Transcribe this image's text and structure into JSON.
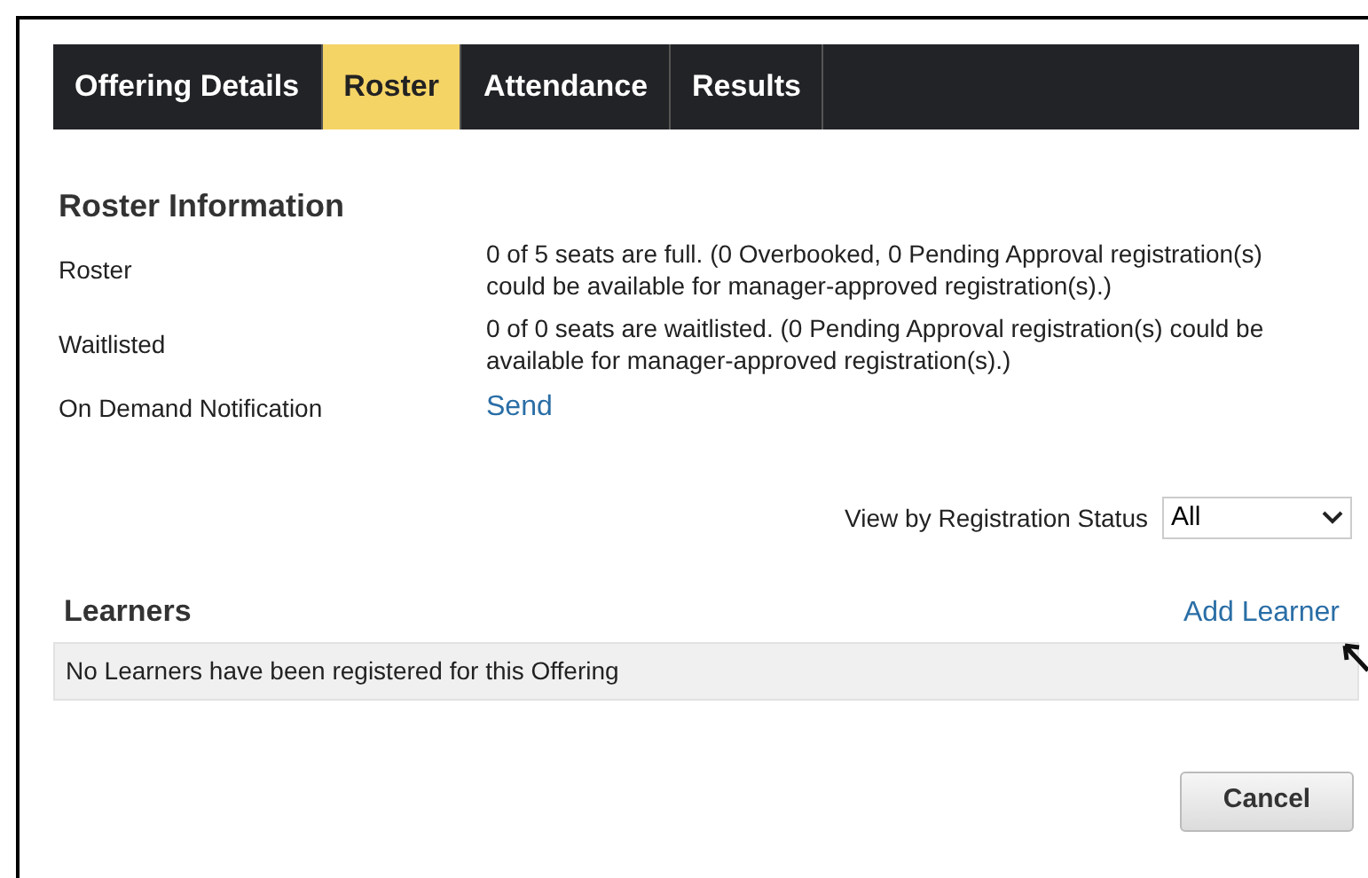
{
  "tabs": [
    {
      "label": "Offering Details",
      "selected": false
    },
    {
      "label": "Roster",
      "selected": true
    },
    {
      "label": "Attendance",
      "selected": false
    },
    {
      "label": "Results",
      "selected": false
    }
  ],
  "roster_information": {
    "title": "Roster Information",
    "rows": [
      {
        "label": "Roster",
        "kind": "text",
        "value": "0 of 5 seats are full. (0 Overbooked, 0 Pending Approval registration(s) could be available for manager-approved registration(s).)"
      },
      {
        "label": "Waitlisted",
        "kind": "text",
        "value": "0 of 0 seats are waitlisted. (0 Pending Approval registration(s) could be available for manager-approved registration(s).)"
      },
      {
        "label": "On Demand Notification",
        "kind": "link",
        "value": "Send"
      }
    ]
  },
  "filter": {
    "label": "View by Registration Status",
    "value": "All"
  },
  "learners": {
    "title": "Learners",
    "add_link": "Add Learner",
    "empty_message": "No Learners have been registered for this Offering"
  },
  "buttons": [
    "Cancel"
  ]
}
